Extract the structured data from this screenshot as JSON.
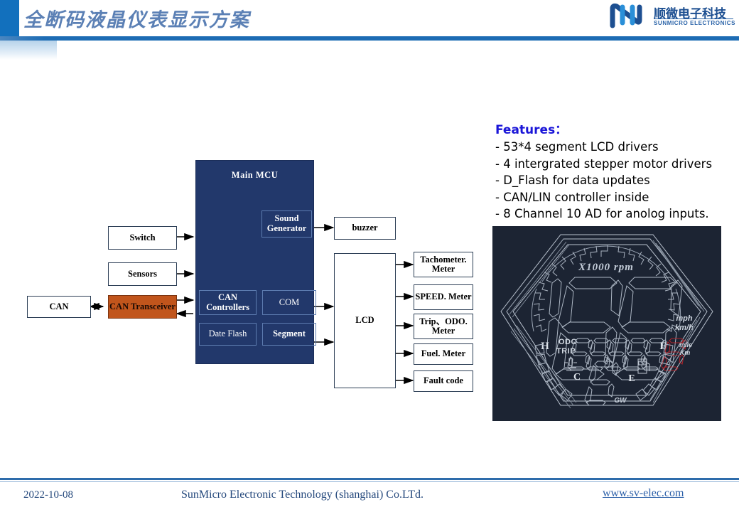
{
  "header": {
    "title": "全断码液晶仪表显示方案",
    "logo": {
      "cn": "顺微电子科技",
      "en": "SUNMICRO ELECTRONICS",
      "icon": "sunmicro-n-logo"
    },
    "accent_color": "#1270bd",
    "rule_color": "#1d6cb4"
  },
  "features": {
    "title": "Features：",
    "title_color": "#1a15d8",
    "items": [
      " - 53*4 segment LCD drivers",
      " - 4 intergrated stepper motor drivers",
      " - D_Flash for data updates",
      " - CAN/LIN controller inside",
      " - 8 Channel 10 AD for anolog inputs."
    ]
  },
  "diagram": {
    "mcu": {
      "title": "Main  MCU",
      "fill": "#22386b",
      "blocks": [
        {
          "label": "Sound Generator",
          "bold": true
        },
        {
          "label": "CAN Controllers",
          "bold": true
        },
        {
          "label": "COM",
          "bold": false
        },
        {
          "label": "Date Flash",
          "bold": false
        },
        {
          "label": "Segment",
          "bold": true
        }
      ]
    },
    "left_blocks": [
      {
        "label": "Switch",
        "style": "white"
      },
      {
        "label": "Sensors",
        "style": "white"
      },
      {
        "label": "CAN",
        "style": "white"
      },
      {
        "label": "CAN Transceiver",
        "style": "orange",
        "fill": "#c1551c"
      }
    ],
    "right_blocks": [
      {
        "label": "buzzer"
      },
      {
        "label": "LCD"
      },
      {
        "label": "Tachometer. Meter"
      },
      {
        "label": "SPEED. Meter"
      },
      {
        "label": "Trip、ODO. Meter"
      },
      {
        "label": "Fuel. Meter"
      },
      {
        "label": "Fault code"
      }
    ]
  },
  "lcd_photo": {
    "background": "#1c2433",
    "stroke": "#b9c2ce",
    "highlight": "#b0232a",
    "labels": {
      "rpm": "X1000 rpm",
      "units_top": "mph",
      "units_bottom": "km/h",
      "odo": "ODO",
      "trip": "TRIP",
      "mile": "mile",
      "km": "Km",
      "h": "H",
      "f": "F",
      "c": "C",
      "e": "E",
      "gear": "GW"
    }
  },
  "footer": {
    "date": "2022-10-08",
    "company": "SunMicro Electronic Technology (shanghai) Co.LTd.",
    "url": "www.sv-elec.com"
  }
}
